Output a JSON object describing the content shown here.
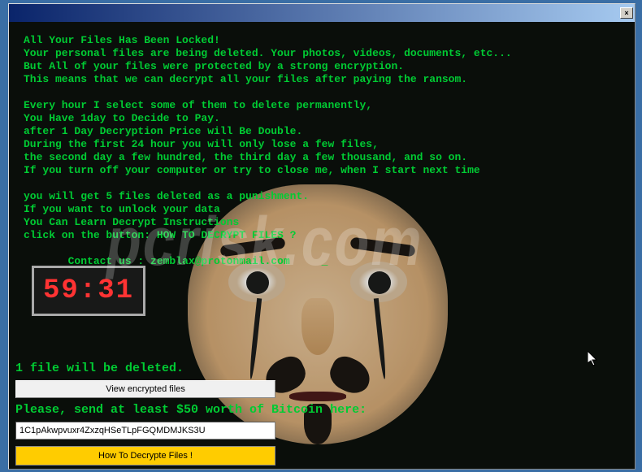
{
  "window": {
    "close_label": "×"
  },
  "threat": {
    "line1": "All Your Files Has Been Locked!",
    "line2": "Your personal files are being deleted. Your photos, videos, documents, etc...",
    "line3": "But All of your files were protected by a strong encryption.",
    "line4": "This means that we can decrypt all your files after paying the ransom.",
    "line5": "",
    "line6": "Every hour I select some of them to delete permanently,",
    "line7": "You Have 1day to Decide to Pay.",
    "line8": "after 1 Day Decryption Price will Be Double.",
    "line9": "During the first 24 hour you will only lose a few files,",
    "line10": "the second day a few hundred, the third day a few thousand, and so on.",
    "line11": "If you turn off your computer or try to close me, when I start next time",
    "line12": "",
    "line13": "you will get 5 files deleted as a punishment.",
    "line14": "If you want to unlock your data",
    "line15": "You Can Learn Decrypt Instructions",
    "line16": "click on the button: HOW TO DECRYPT FILES ?",
    "line17": "",
    "contact": "       Contact us : zemblax@protonmail.com     _"
  },
  "timer": {
    "value": "59:31"
  },
  "bottom": {
    "delete_warning": "1 file will be deleted.",
    "view_btn": "View encrypted files",
    "bitcoin_msg": "Please, send at least $50 worth of Bitcoin here:",
    "btc_address": "1C1pAkwpvuxr4ZxzqHSeTLpFGQMDMJKS3U",
    "decrypt_btn": "How To Decrypte Files !"
  },
  "watermark": "pcrisk.com"
}
